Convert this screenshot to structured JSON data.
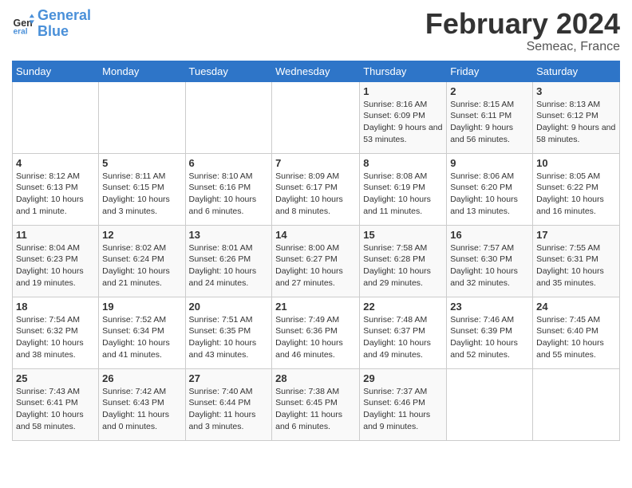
{
  "header": {
    "logo_line1": "General",
    "logo_line2": "Blue",
    "title": "February 2024",
    "subtitle": "Semeac, France"
  },
  "weekdays": [
    "Sunday",
    "Monday",
    "Tuesday",
    "Wednesday",
    "Thursday",
    "Friday",
    "Saturday"
  ],
  "weeks": [
    [
      {
        "day": "",
        "info": ""
      },
      {
        "day": "",
        "info": ""
      },
      {
        "day": "",
        "info": ""
      },
      {
        "day": "",
        "info": ""
      },
      {
        "day": "1",
        "info": "Sunrise: 8:16 AM\nSunset: 6:09 PM\nDaylight: 9 hours and 53 minutes."
      },
      {
        "day": "2",
        "info": "Sunrise: 8:15 AM\nSunset: 6:11 PM\nDaylight: 9 hours and 56 minutes."
      },
      {
        "day": "3",
        "info": "Sunrise: 8:13 AM\nSunset: 6:12 PM\nDaylight: 9 hours and 58 minutes."
      }
    ],
    [
      {
        "day": "4",
        "info": "Sunrise: 8:12 AM\nSunset: 6:13 PM\nDaylight: 10 hours and 1 minute."
      },
      {
        "day": "5",
        "info": "Sunrise: 8:11 AM\nSunset: 6:15 PM\nDaylight: 10 hours and 3 minutes."
      },
      {
        "day": "6",
        "info": "Sunrise: 8:10 AM\nSunset: 6:16 PM\nDaylight: 10 hours and 6 minutes."
      },
      {
        "day": "7",
        "info": "Sunrise: 8:09 AM\nSunset: 6:17 PM\nDaylight: 10 hours and 8 minutes."
      },
      {
        "day": "8",
        "info": "Sunrise: 8:08 AM\nSunset: 6:19 PM\nDaylight: 10 hours and 11 minutes."
      },
      {
        "day": "9",
        "info": "Sunrise: 8:06 AM\nSunset: 6:20 PM\nDaylight: 10 hours and 13 minutes."
      },
      {
        "day": "10",
        "info": "Sunrise: 8:05 AM\nSunset: 6:22 PM\nDaylight: 10 hours and 16 minutes."
      }
    ],
    [
      {
        "day": "11",
        "info": "Sunrise: 8:04 AM\nSunset: 6:23 PM\nDaylight: 10 hours and 19 minutes."
      },
      {
        "day": "12",
        "info": "Sunrise: 8:02 AM\nSunset: 6:24 PM\nDaylight: 10 hours and 21 minutes."
      },
      {
        "day": "13",
        "info": "Sunrise: 8:01 AM\nSunset: 6:26 PM\nDaylight: 10 hours and 24 minutes."
      },
      {
        "day": "14",
        "info": "Sunrise: 8:00 AM\nSunset: 6:27 PM\nDaylight: 10 hours and 27 minutes."
      },
      {
        "day": "15",
        "info": "Sunrise: 7:58 AM\nSunset: 6:28 PM\nDaylight: 10 hours and 29 minutes."
      },
      {
        "day": "16",
        "info": "Sunrise: 7:57 AM\nSunset: 6:30 PM\nDaylight: 10 hours and 32 minutes."
      },
      {
        "day": "17",
        "info": "Sunrise: 7:55 AM\nSunset: 6:31 PM\nDaylight: 10 hours and 35 minutes."
      }
    ],
    [
      {
        "day": "18",
        "info": "Sunrise: 7:54 AM\nSunset: 6:32 PM\nDaylight: 10 hours and 38 minutes."
      },
      {
        "day": "19",
        "info": "Sunrise: 7:52 AM\nSunset: 6:34 PM\nDaylight: 10 hours and 41 minutes."
      },
      {
        "day": "20",
        "info": "Sunrise: 7:51 AM\nSunset: 6:35 PM\nDaylight: 10 hours and 43 minutes."
      },
      {
        "day": "21",
        "info": "Sunrise: 7:49 AM\nSunset: 6:36 PM\nDaylight: 10 hours and 46 minutes."
      },
      {
        "day": "22",
        "info": "Sunrise: 7:48 AM\nSunset: 6:37 PM\nDaylight: 10 hours and 49 minutes."
      },
      {
        "day": "23",
        "info": "Sunrise: 7:46 AM\nSunset: 6:39 PM\nDaylight: 10 hours and 52 minutes."
      },
      {
        "day": "24",
        "info": "Sunrise: 7:45 AM\nSunset: 6:40 PM\nDaylight: 10 hours and 55 minutes."
      }
    ],
    [
      {
        "day": "25",
        "info": "Sunrise: 7:43 AM\nSunset: 6:41 PM\nDaylight: 10 hours and 58 minutes."
      },
      {
        "day": "26",
        "info": "Sunrise: 7:42 AM\nSunset: 6:43 PM\nDaylight: 11 hours and 0 minutes."
      },
      {
        "day": "27",
        "info": "Sunrise: 7:40 AM\nSunset: 6:44 PM\nDaylight: 11 hours and 3 minutes."
      },
      {
        "day": "28",
        "info": "Sunrise: 7:38 AM\nSunset: 6:45 PM\nDaylight: 11 hours and 6 minutes."
      },
      {
        "day": "29",
        "info": "Sunrise: 7:37 AM\nSunset: 6:46 PM\nDaylight: 11 hours and 9 minutes."
      },
      {
        "day": "",
        "info": ""
      },
      {
        "day": "",
        "info": ""
      }
    ]
  ]
}
